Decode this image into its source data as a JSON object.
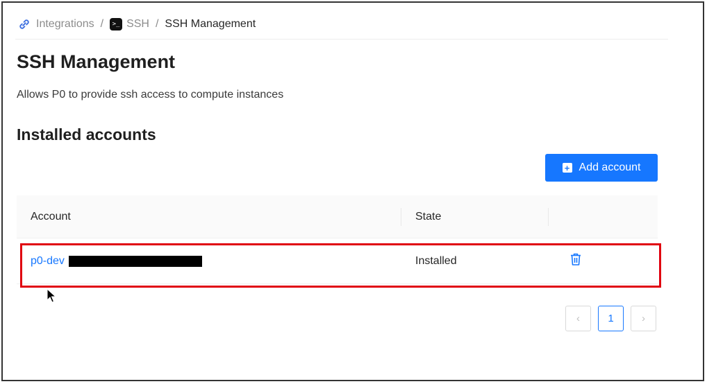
{
  "breadcrumb": {
    "integrations": "Integrations",
    "ssh": "SSH",
    "current": "SSH Management",
    "separator": "/"
  },
  "page": {
    "title": "SSH Management",
    "description": "Allows P0 to provide ssh access to compute instances"
  },
  "section": {
    "title": "Installed accounts"
  },
  "toolbar": {
    "add_label": "Add account"
  },
  "table": {
    "headers": {
      "account": "Account",
      "state": "State"
    },
    "rows": [
      {
        "account": "p0-dev",
        "state": "Installed"
      }
    ]
  },
  "pagination": {
    "prev": "‹",
    "current": "1",
    "next": "›"
  },
  "colors": {
    "accent": "#1677ff",
    "highlight": "#e0000f"
  },
  "icons": {
    "integrations": "link-icon",
    "ssh": "terminal-icon",
    "add": "plus-square-icon",
    "delete": "trash-icon"
  }
}
